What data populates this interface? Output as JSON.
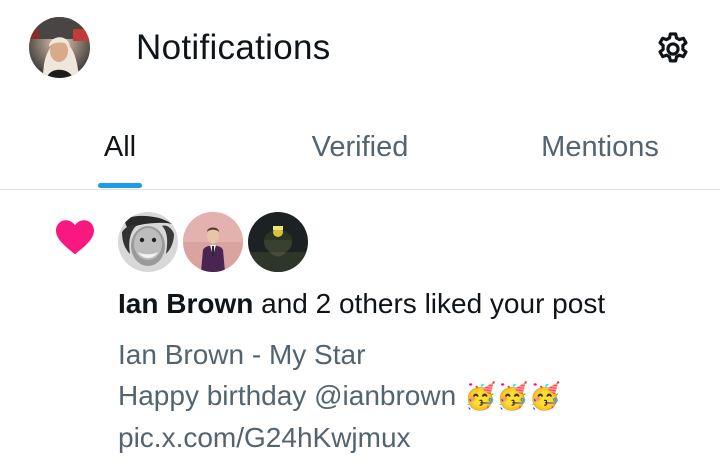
{
  "header": {
    "title": "Notifications",
    "avatar_icon": "profile-avatar",
    "settings_icon": "gear-icon"
  },
  "tabs": [
    {
      "label": "All",
      "active": true
    },
    {
      "label": "Verified",
      "active": false
    },
    {
      "label": "Mentions",
      "active": false
    }
  ],
  "notification": {
    "icon": "heart-icon",
    "icon_color": "#f91880",
    "avatars": [
      "ian-brown-avatar",
      "liker-2-avatar",
      "liker-3-avatar"
    ],
    "actor_name": "Ian Brown",
    "action_text": " and 2 others liked your post",
    "post": {
      "line1": "Ian Brown - My Star",
      "line2": "Happy birthday @ianbrown ",
      "line2_emoji": "🥳🥳🥳",
      "line3": "pic.x.com/G24hKwjmux"
    }
  },
  "colors": {
    "accent": "#1d9bf0",
    "text_primary": "#0f1419",
    "text_secondary": "#536471",
    "divider": "#dfe3e6"
  }
}
